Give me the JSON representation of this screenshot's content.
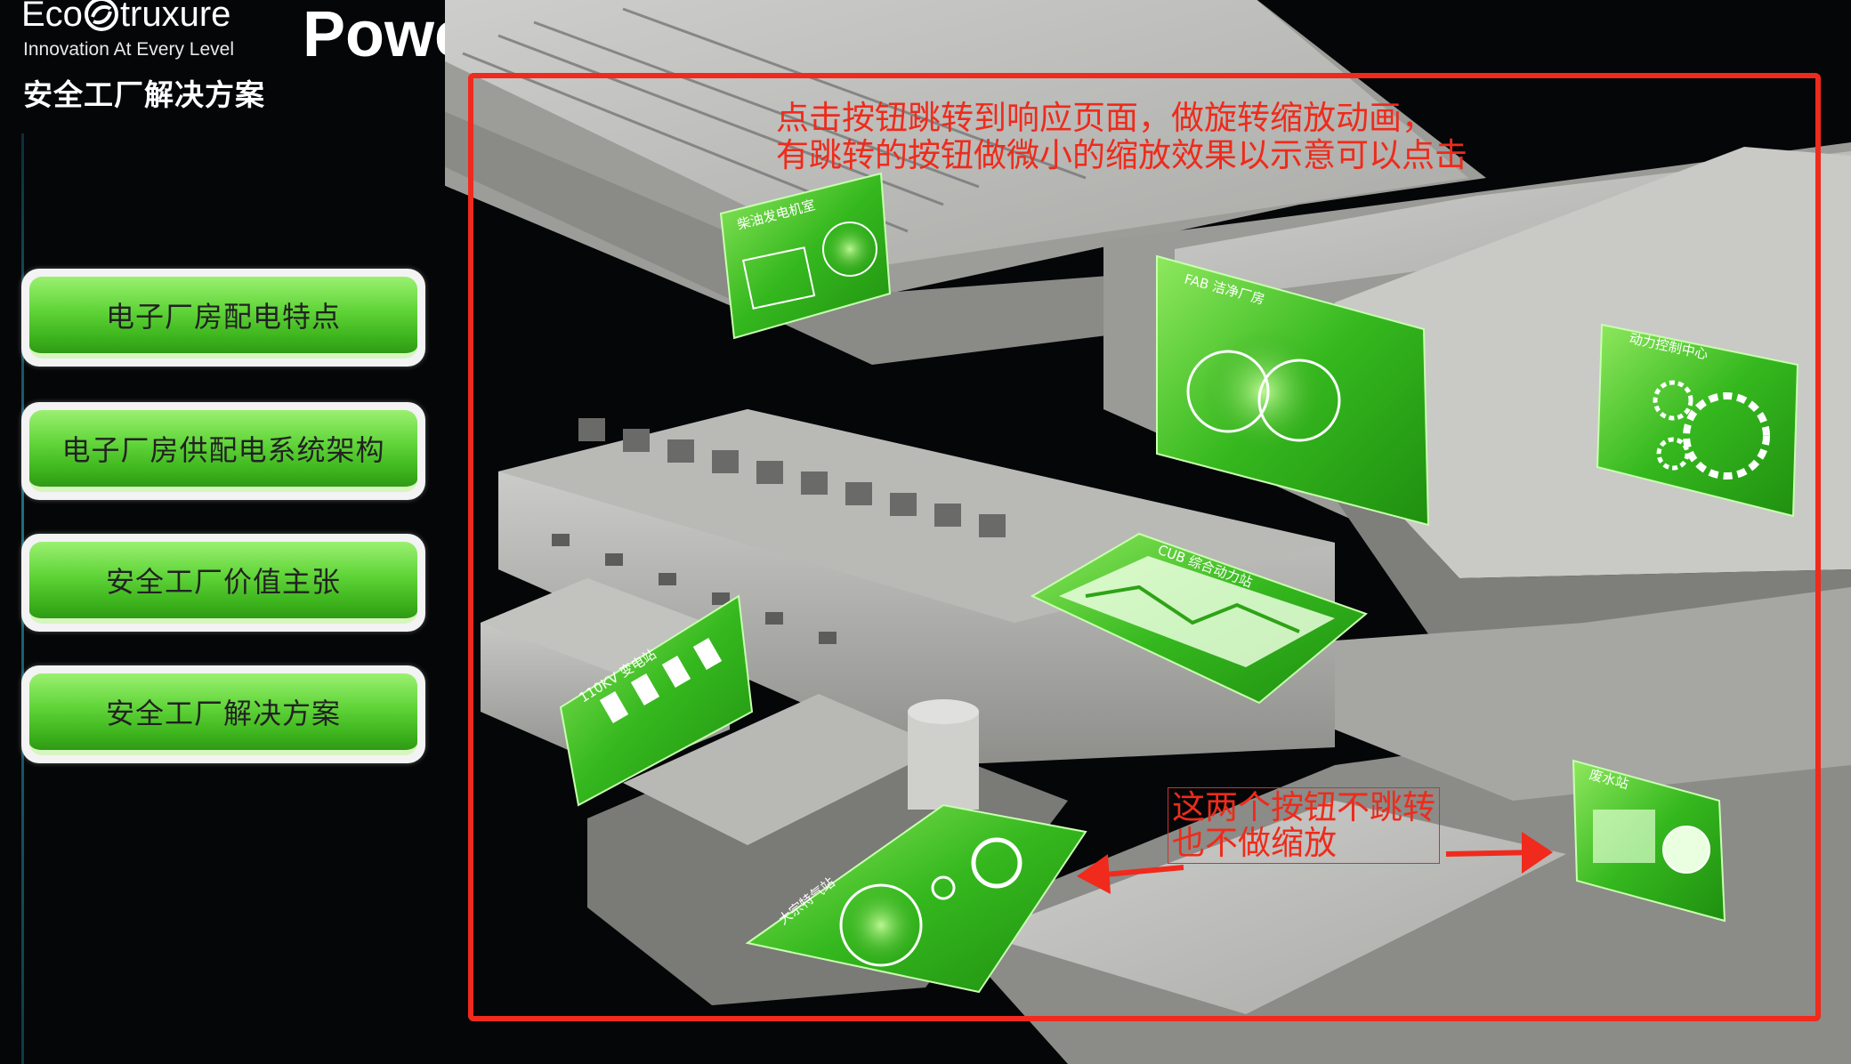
{
  "brand": {
    "eco_left": "Eco",
    "eco_right": "truxure",
    "tagline": "Innovation At Every Level",
    "subtitle": "安全工厂解决方案",
    "product": "Power"
  },
  "nav": [
    {
      "label": "电子厂房配电特点"
    },
    {
      "label": "电子厂房供配电系统架构"
    },
    {
      "label": "安全工厂价值主张"
    },
    {
      "label": "安全工厂解决方案"
    }
  ],
  "panels": [
    {
      "label": "柴油发电机室"
    },
    {
      "label": "FAB 洁净厂房"
    },
    {
      "label": "动力控制中心"
    },
    {
      "label": "CUB 综合动力站"
    },
    {
      "label": "110KV 变电站"
    },
    {
      "label": "大宗特气站"
    },
    {
      "label": "废水站"
    }
  ],
  "annotations": {
    "top_line1": "点击按钮跳转到响应页面，做旋转缩放动画，",
    "top_line2": "有跳转的按钮做微小的缩放效果以示意可以点击",
    "bottom_line1": "这两个按钮不跳转",
    "bottom_line2": "也不做缩放"
  },
  "colors": {
    "accent_green": "#5fd438",
    "annotation_red": "#f02a1c",
    "background": "#050608"
  }
}
